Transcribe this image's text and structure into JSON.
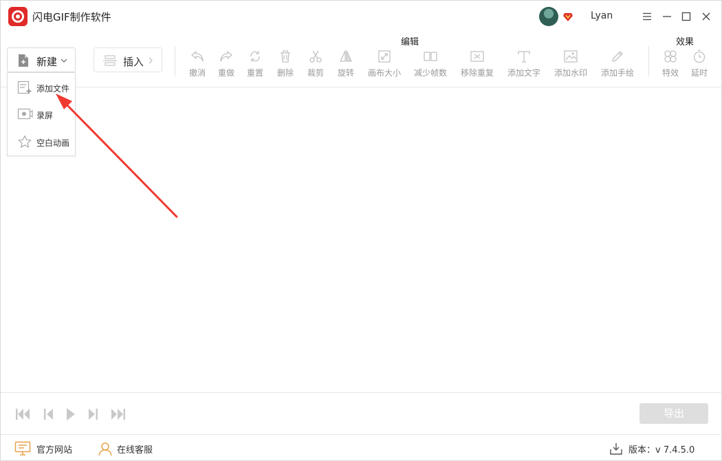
{
  "app": {
    "title": "闪电GIF制作软件"
  },
  "user": {
    "name": "Lyan"
  },
  "toolbar": {
    "new_label": "新建",
    "insert_label": "插入",
    "group_edit": "编辑",
    "group_effects": "效果",
    "tools": {
      "undo": "撤消",
      "redo": "重做",
      "reset": "重置",
      "delete": "删除",
      "crop": "裁剪",
      "rotate": "旋转",
      "canvas_size": "画布大小",
      "reduce_frames": "减少帧数",
      "remove_duplicates": "移除重复",
      "add_text": "添加文字",
      "add_watermark": "添加水印",
      "add_handwriting": "添加手绘",
      "effects": "特效",
      "delay": "延时"
    }
  },
  "new_menu": {
    "add_file": "添加文件",
    "record_screen": "录屏",
    "blank_animation": "空白动画"
  },
  "playback": {
    "export_label": "导出"
  },
  "statusbar": {
    "website": "官方网站",
    "support": "在线客服",
    "version": "版本：v 7.4.5.0"
  },
  "colors": {
    "brand": "#e02a2a",
    "annotation": "#f03a30",
    "disabled": "#b9b9b9",
    "website_icon": "#e8a24a"
  }
}
